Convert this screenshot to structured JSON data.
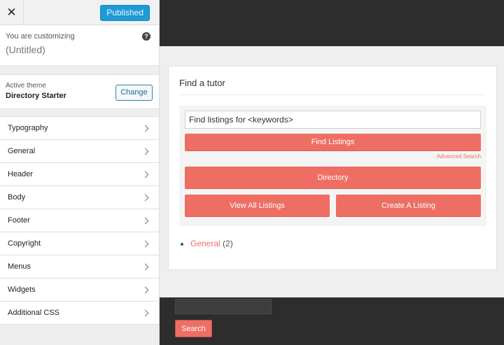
{
  "header": {
    "close_symbol": "✕",
    "publish_label": "Published"
  },
  "customizing": {
    "label": "You are customizing",
    "site_title": "(Untitled)",
    "help_symbol": "?"
  },
  "theme": {
    "label": "Active theme",
    "name": "Directory Starter",
    "change_label": "Change"
  },
  "sidebar": {
    "items": [
      {
        "label": "Typography"
      },
      {
        "label": "General"
      },
      {
        "label": "Header"
      },
      {
        "label": "Body"
      },
      {
        "label": "Footer"
      },
      {
        "label": "Copyright"
      },
      {
        "label": "Menus"
      },
      {
        "label": "Widgets"
      },
      {
        "label": "Additional CSS"
      }
    ]
  },
  "preview": {
    "widget_title": "Find a tutor",
    "keyword_value": "Find listings for <keywords>",
    "find_listings_label": "Find Listings",
    "advanced_search_label": "Advanced Search",
    "directory_label": "Directory",
    "view_all_label": "View All Listings",
    "create_label": "Create A Listing",
    "categories": [
      {
        "name": "General",
        "count": "(2)"
      }
    ],
    "footer_search_label": "Search"
  },
  "colors": {
    "accent": "#ee6e63",
    "publish_blue": "#1e9ad6",
    "dark_bar": "#2d2d2d"
  }
}
